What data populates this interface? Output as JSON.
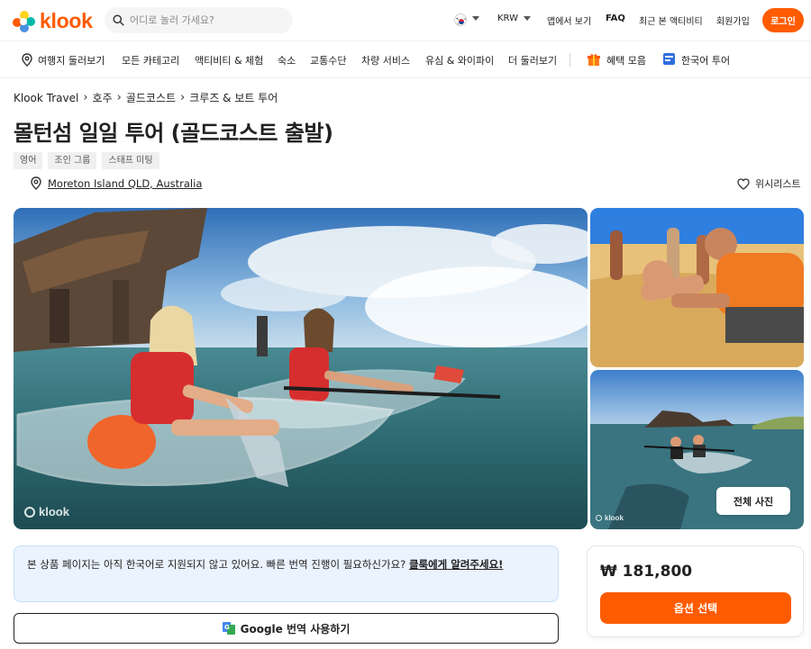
{
  "header": {
    "logo_text": "klook",
    "search_placeholder": "어디로 놀러 가세요?",
    "currency": "KRW",
    "app_link": "앱에서 보기",
    "faq": "FAQ",
    "recently_viewed": "최근 본 액티비티",
    "signup": "회원가입",
    "login": "로그인"
  },
  "nav": {
    "items": [
      "여행지 둘러보기",
      "모든 카테고리",
      "액티비티 & 체험",
      "숙소",
      "교통수단",
      "차량 서비스",
      "유심 & 와이파이",
      "더 둘러보기"
    ],
    "promos": [
      "혜택 모음",
      "한국어 투어"
    ]
  },
  "breadcrumb": [
    "Klook Travel",
    "호주",
    "골드코스트",
    "크루즈 & 보트 투어"
  ],
  "product": {
    "title": "몰턴섬 일일 투어 (골드코스트 출발)",
    "tags": [
      "영어",
      "조인 그룹",
      "스태프 미팅"
    ],
    "location": "Moreton Island QLD, Australia",
    "wishlist": "위시리스트"
  },
  "gallery": {
    "watermark": "klook",
    "all_photos": "전체 사진"
  },
  "notice": {
    "text": "본 상품 페이지는 아직 한국어로 지원되지 않고 있어요. 빠른 번역 진행이 필요하신가요?",
    "link": "클룩에게 알려주세요!"
  },
  "google_translate": "Google 번역 사용하기",
  "booking": {
    "price": "₩ 181,800",
    "select_option": "옵션 선택"
  },
  "colors": {
    "brand": "#ff5b00",
    "notice_bg": "#eaf3fe"
  }
}
